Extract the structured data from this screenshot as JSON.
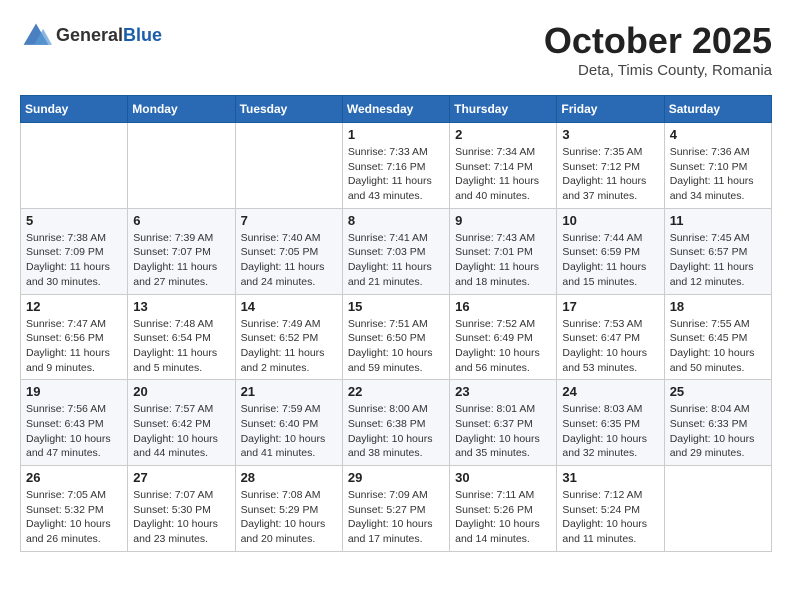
{
  "header": {
    "logo_general": "General",
    "logo_blue": "Blue",
    "month_title": "October 2025",
    "location": "Deta, Timis County, Romania"
  },
  "weekdays": [
    "Sunday",
    "Monday",
    "Tuesday",
    "Wednesday",
    "Thursday",
    "Friday",
    "Saturday"
  ],
  "weeks": [
    [
      {
        "day": "",
        "info": ""
      },
      {
        "day": "",
        "info": ""
      },
      {
        "day": "",
        "info": ""
      },
      {
        "day": "1",
        "info": "Sunrise: 7:33 AM\nSunset: 7:16 PM\nDaylight: 11 hours\nand 43 minutes."
      },
      {
        "day": "2",
        "info": "Sunrise: 7:34 AM\nSunset: 7:14 PM\nDaylight: 11 hours\nand 40 minutes."
      },
      {
        "day": "3",
        "info": "Sunrise: 7:35 AM\nSunset: 7:12 PM\nDaylight: 11 hours\nand 37 minutes."
      },
      {
        "day": "4",
        "info": "Sunrise: 7:36 AM\nSunset: 7:10 PM\nDaylight: 11 hours\nand 34 minutes."
      }
    ],
    [
      {
        "day": "5",
        "info": "Sunrise: 7:38 AM\nSunset: 7:09 PM\nDaylight: 11 hours\nand 30 minutes."
      },
      {
        "day": "6",
        "info": "Sunrise: 7:39 AM\nSunset: 7:07 PM\nDaylight: 11 hours\nand 27 minutes."
      },
      {
        "day": "7",
        "info": "Sunrise: 7:40 AM\nSunset: 7:05 PM\nDaylight: 11 hours\nand 24 minutes."
      },
      {
        "day": "8",
        "info": "Sunrise: 7:41 AM\nSunset: 7:03 PM\nDaylight: 11 hours\nand 21 minutes."
      },
      {
        "day": "9",
        "info": "Sunrise: 7:43 AM\nSunset: 7:01 PM\nDaylight: 11 hours\nand 18 minutes."
      },
      {
        "day": "10",
        "info": "Sunrise: 7:44 AM\nSunset: 6:59 PM\nDaylight: 11 hours\nand 15 minutes."
      },
      {
        "day": "11",
        "info": "Sunrise: 7:45 AM\nSunset: 6:57 PM\nDaylight: 11 hours\nand 12 minutes."
      }
    ],
    [
      {
        "day": "12",
        "info": "Sunrise: 7:47 AM\nSunset: 6:56 PM\nDaylight: 11 hours\nand 9 minutes."
      },
      {
        "day": "13",
        "info": "Sunrise: 7:48 AM\nSunset: 6:54 PM\nDaylight: 11 hours\nand 5 minutes."
      },
      {
        "day": "14",
        "info": "Sunrise: 7:49 AM\nSunset: 6:52 PM\nDaylight: 11 hours\nand 2 minutes."
      },
      {
        "day": "15",
        "info": "Sunrise: 7:51 AM\nSunset: 6:50 PM\nDaylight: 10 hours\nand 59 minutes."
      },
      {
        "day": "16",
        "info": "Sunrise: 7:52 AM\nSunset: 6:49 PM\nDaylight: 10 hours\nand 56 minutes."
      },
      {
        "day": "17",
        "info": "Sunrise: 7:53 AM\nSunset: 6:47 PM\nDaylight: 10 hours\nand 53 minutes."
      },
      {
        "day": "18",
        "info": "Sunrise: 7:55 AM\nSunset: 6:45 PM\nDaylight: 10 hours\nand 50 minutes."
      }
    ],
    [
      {
        "day": "19",
        "info": "Sunrise: 7:56 AM\nSunset: 6:43 PM\nDaylight: 10 hours\nand 47 minutes."
      },
      {
        "day": "20",
        "info": "Sunrise: 7:57 AM\nSunset: 6:42 PM\nDaylight: 10 hours\nand 44 minutes."
      },
      {
        "day": "21",
        "info": "Sunrise: 7:59 AM\nSunset: 6:40 PM\nDaylight: 10 hours\nand 41 minutes."
      },
      {
        "day": "22",
        "info": "Sunrise: 8:00 AM\nSunset: 6:38 PM\nDaylight: 10 hours\nand 38 minutes."
      },
      {
        "day": "23",
        "info": "Sunrise: 8:01 AM\nSunset: 6:37 PM\nDaylight: 10 hours\nand 35 minutes."
      },
      {
        "day": "24",
        "info": "Sunrise: 8:03 AM\nSunset: 6:35 PM\nDaylight: 10 hours\nand 32 minutes."
      },
      {
        "day": "25",
        "info": "Sunrise: 8:04 AM\nSunset: 6:33 PM\nDaylight: 10 hours\nand 29 minutes."
      }
    ],
    [
      {
        "day": "26",
        "info": "Sunrise: 7:05 AM\nSunset: 5:32 PM\nDaylight: 10 hours\nand 26 minutes."
      },
      {
        "day": "27",
        "info": "Sunrise: 7:07 AM\nSunset: 5:30 PM\nDaylight: 10 hours\nand 23 minutes."
      },
      {
        "day": "28",
        "info": "Sunrise: 7:08 AM\nSunset: 5:29 PM\nDaylight: 10 hours\nand 20 minutes."
      },
      {
        "day": "29",
        "info": "Sunrise: 7:09 AM\nSunset: 5:27 PM\nDaylight: 10 hours\nand 17 minutes."
      },
      {
        "day": "30",
        "info": "Sunrise: 7:11 AM\nSunset: 5:26 PM\nDaylight: 10 hours\nand 14 minutes."
      },
      {
        "day": "31",
        "info": "Sunrise: 7:12 AM\nSunset: 5:24 PM\nDaylight: 10 hours\nand 11 minutes."
      },
      {
        "day": "",
        "info": ""
      }
    ]
  ]
}
